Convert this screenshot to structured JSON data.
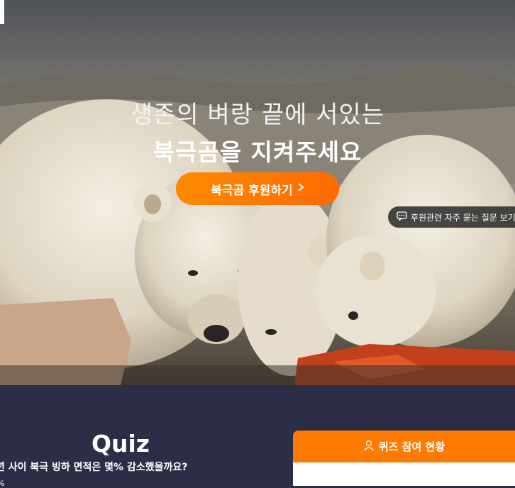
{
  "hero": {
    "headline_line1": "생존의 벼랑 끝에 서있는",
    "headline_line2": "북극곰을 지켜주세요",
    "cta_label": "북극곰 후원하기",
    "faq_label": "후원관련 자주 묻는 질문 보기"
  },
  "quiz": {
    "title": "Quiz",
    "question": "년 사이 북극 빙하 면적은 몇% 감소했을까요?",
    "partial_option": "%"
  },
  "participation_panel": {
    "title": "퀴즈 참여 현황"
  },
  "colors": {
    "accent_orange": "#ff7a00",
    "bottom_bg": "#2c2e47"
  },
  "icons": {
    "cta": "chevron-right-icon",
    "faq": "chat-bubble-icon",
    "panel": "user-icon"
  }
}
